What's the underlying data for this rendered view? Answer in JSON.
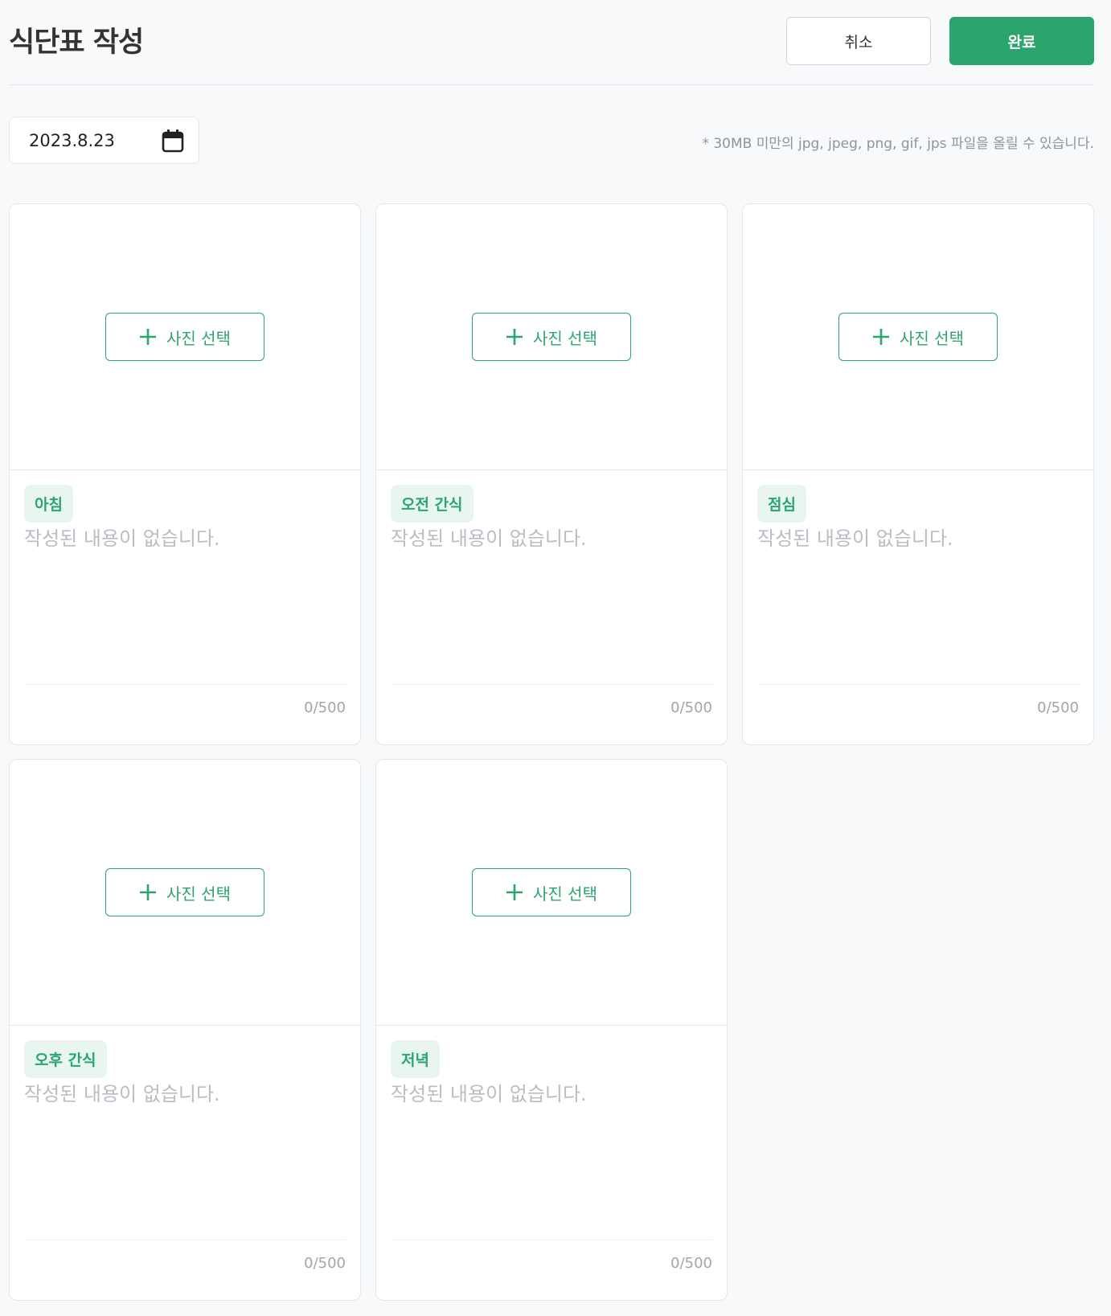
{
  "header": {
    "title": "식단표 작성",
    "cancel_label": "취소",
    "done_label": "완료"
  },
  "date": {
    "value": "2023.8.23",
    "icon": "calendar-icon"
  },
  "upload_hint": "* 30MB 미만의 jpg, jpeg, png, gif, jps 파일을 올릴 수 있습니다.",
  "colors": {
    "accent": "#2ba46e",
    "tag_bg": "#e8f6ef"
  },
  "cards": [
    {
      "tag": "아침",
      "photo_button": "사진 선택",
      "placeholder": "작성된 내용이 없습니다.",
      "counter": "0/500"
    },
    {
      "tag": "오전 간식",
      "photo_button": "사진 선택",
      "placeholder": "작성된 내용이 없습니다.",
      "counter": "0/500"
    },
    {
      "tag": "점심",
      "photo_button": "사진 선택",
      "placeholder": "작성된 내용이 없습니다.",
      "counter": "0/500"
    },
    {
      "tag": "오후 간식",
      "photo_button": "사진 선택",
      "placeholder": "작성된 내용이 없습니다.",
      "counter": "0/500"
    },
    {
      "tag": "저녁",
      "photo_button": "사진 선택",
      "placeholder": "작성된 내용이 없습니다.",
      "counter": "0/500"
    }
  ]
}
